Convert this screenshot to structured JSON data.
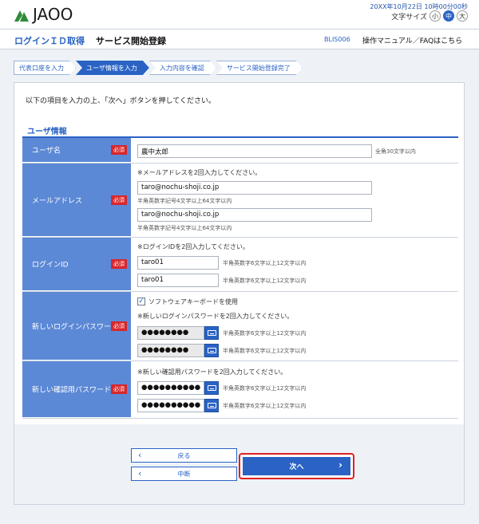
{
  "header": {
    "logo_text": "JAOO",
    "datetime": "20XX年10月22日 10時00分00秒",
    "fontsize_label": "文字サイズ",
    "fontsize_small": "小",
    "fontsize_medium": "中",
    "fontsize_large": "大"
  },
  "subnav": {
    "login_id": "ログインＩＤ取得",
    "service": "サービス開始登録",
    "screen_code": "BLIS006",
    "manual": "操作マニュアル／FAQはこちら"
  },
  "steps": [
    {
      "label": "代表口座を入力"
    },
    {
      "label": "ユーザ情報を入力"
    },
    {
      "label": "入力内容を確認"
    },
    {
      "label": "サービス開始登録完了"
    }
  ],
  "instruction": "以下の項目を入力の上、「次へ」ボタンを押してください。",
  "section_title": "ユーザ情報",
  "required_label": "必須",
  "form": {
    "username": {
      "label": "ユーザ名",
      "value": "農中太郎",
      "hint": "全角30文字以内"
    },
    "email": {
      "label": "メールアドレス",
      "note": "※メールアドレスを2回入力してください。",
      "value1": "taro@nochu-shoji.co.jp",
      "value2": "taro@nochu-shoji.co.jp",
      "hint": "半角英数字記号4文字以上64文字以内"
    },
    "login_id": {
      "label": "ログインID",
      "note": "※ログインIDを2回入力してください。",
      "value1": "taro01",
      "value2": "taro01",
      "hint": "半角英数字6文字以上12文字以内"
    },
    "login_password": {
      "label": "新しいログインパスワード",
      "keyboard_label": "ソフトウェアキーボードを使用",
      "note": "※新しいログインパスワードを2回入力してください。",
      "value1": "●●●●●●●●",
      "value2": "●●●●●●●●",
      "hint": "半角英数字6文字以上12文字以内"
    },
    "confirm_password": {
      "label": "新しい確認用パスワード",
      "note": "※新しい確認用パスワードを2回入力してください。",
      "value1": "●●●●●●●●●●",
      "value2": "●●●●●●●●●●",
      "hint": "半角英数字6文字以上12文字以内"
    }
  },
  "buttons": {
    "back": "戻る",
    "cancel": "中断",
    "next": "次へ"
  },
  "colors": {
    "accent": "#2a63c4",
    "label_bg": "#5c89d6",
    "required": "#d8262b",
    "highlight": "#e02020"
  }
}
